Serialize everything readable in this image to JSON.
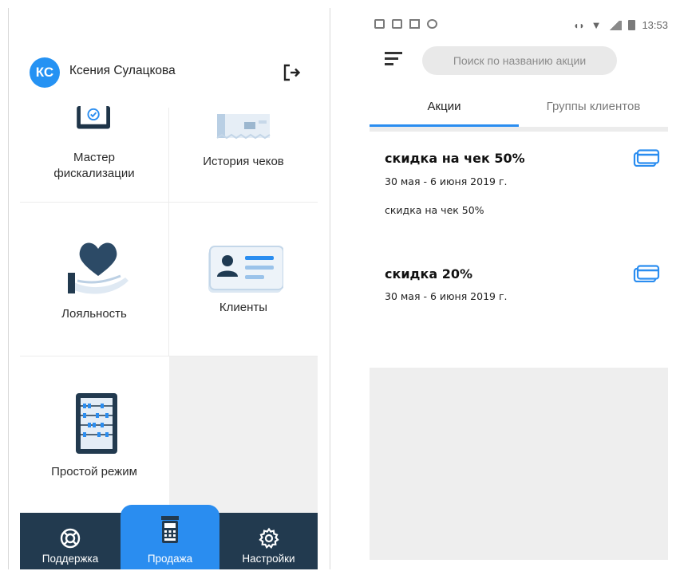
{
  "left": {
    "user": {
      "initials": "КС",
      "name": "Ксения Сулацкова"
    },
    "tiles": [
      {
        "label_line1": "Мастер",
        "label_line2": "фискализации"
      },
      {
        "label": "История чеков"
      },
      {
        "label": "Лояльность"
      },
      {
        "label": "Клиенты"
      },
      {
        "label": "Простой режим"
      }
    ],
    "bottom_nav": [
      {
        "label": "Поддержка",
        "icon": "lifebuoy-icon"
      },
      {
        "label": "Продажа",
        "icon": "register-icon",
        "active": true
      },
      {
        "label": "Настройки",
        "icon": "gear-icon"
      }
    ],
    "colors": {
      "accent": "#2a8df0",
      "nav_bg": "#223a4f",
      "avatar": "#2592f3"
    }
  },
  "right": {
    "status_bar": {
      "time": "13:53"
    },
    "search": {
      "placeholder": "Поиск по названию акции"
    },
    "tabs": [
      {
        "label": "Акции",
        "active": true
      },
      {
        "label": "Группы клиентов",
        "active": false
      }
    ],
    "promotions": [
      {
        "title": "скидка на чек 50%",
        "dates": "30 мая - 6 июня 2019 г.",
        "description": "скидка на чек 50%"
      },
      {
        "title": "скидка 20%",
        "dates": "30 мая - 6 июня 2019 г.",
        "description": ""
      }
    ]
  }
}
